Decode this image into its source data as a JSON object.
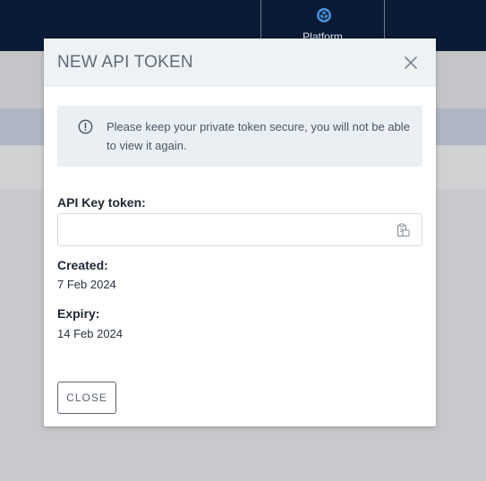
{
  "nav": {
    "platform_label": "Platform",
    "platform_icon": "cube-icon"
  },
  "modal": {
    "title": "NEW API TOKEN",
    "close_icon": "close-icon",
    "alert": {
      "icon": "info-icon",
      "text": "Please keep your private token secure, you will not be able to view it again."
    },
    "token": {
      "label": "API Key token:",
      "value": "",
      "copy_icon": "copy-clipboard-icon"
    },
    "created": {
      "label": "Created:",
      "value": "7 Feb 2024"
    },
    "expiry": {
      "label": "Expiry:",
      "value": "14 Feb 2024"
    },
    "close_button_label": "CLOSE"
  },
  "colors": {
    "topbar": "#0b1b36",
    "accent": "#4a8fd6",
    "modal_header": "#eef2f5",
    "alert_bg": "#eaeff3",
    "overlay": "#c7c9cc"
  }
}
